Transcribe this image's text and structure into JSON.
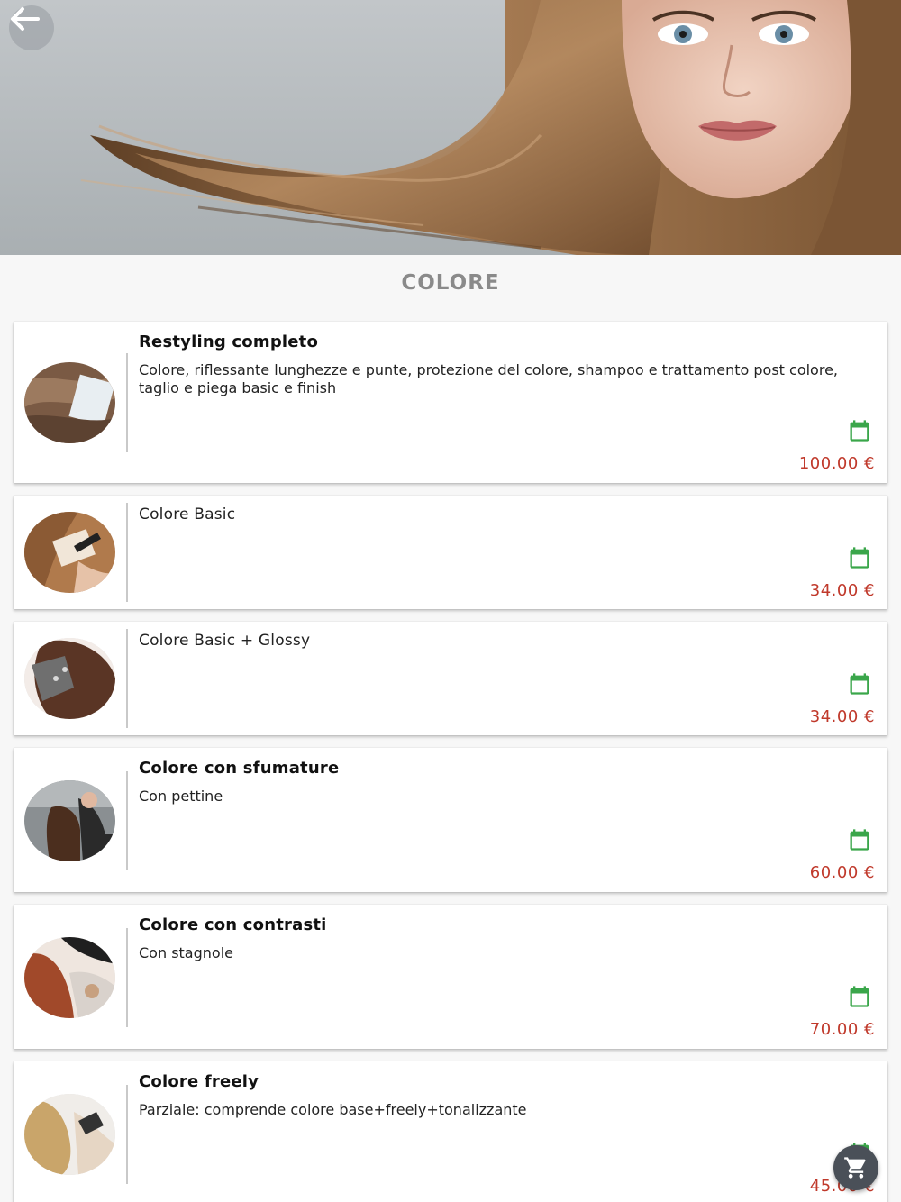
{
  "section": {
    "title": "COLORE"
  },
  "colors": {
    "accent_green": "#3aa64a",
    "price_red": "#c0392b",
    "title_gray": "#8a8a8a"
  },
  "services": [
    {
      "title": "Restyling completo",
      "description": "Colore, riflessante lunghezze e punte, protezione del colore, shampoo e trattamento post colore, taglio e piega basic e finish",
      "price": "100.00 €"
    },
    {
      "title": "Colore Basic",
      "description": "",
      "price": "34.00 €"
    },
    {
      "title": "Colore Basic + Glossy",
      "description": "",
      "price": "34.00 €"
    },
    {
      "title": "Colore con sfumature",
      "description": "Con pettine",
      "price": "60.00 €"
    },
    {
      "title": "Colore con contrasti",
      "description": "Con stagnole",
      "price": "70.00 €"
    },
    {
      "title": "Colore freely",
      "description": "Parziale: comprende colore base+freely+tonalizzante",
      "price": "45.00 €"
    }
  ],
  "icons": {
    "back": "arrow-left-icon",
    "calendar": "calendar-icon",
    "cart": "cart-icon"
  }
}
